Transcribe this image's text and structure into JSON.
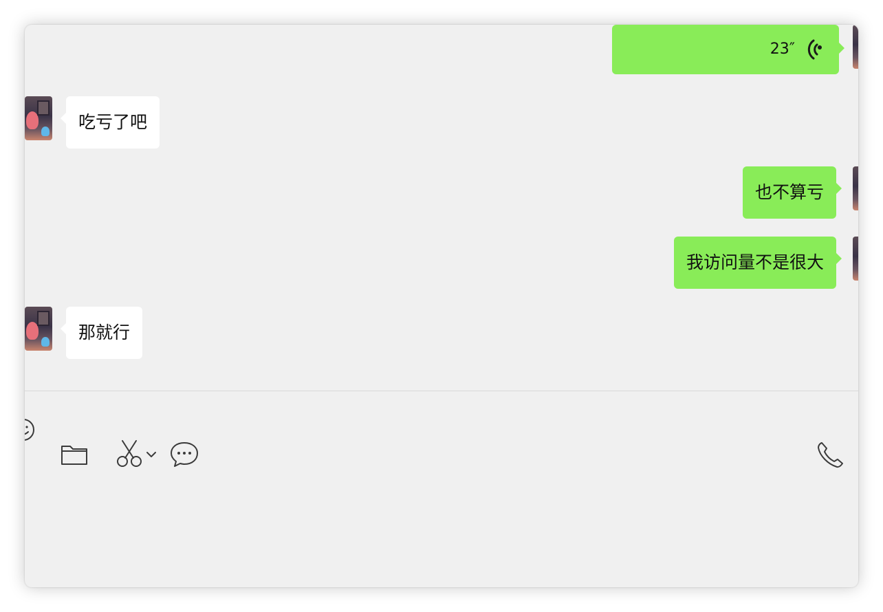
{
  "messages": [
    {
      "direction": "out",
      "type": "voice",
      "duration": "23″",
      "icon": "voice-wave-icon"
    },
    {
      "direction": "in",
      "type": "text",
      "text": "吃亏了吧"
    },
    {
      "direction": "out",
      "type": "text",
      "text": "也不算亏"
    },
    {
      "direction": "out",
      "type": "text",
      "text": "我访问量不是很大"
    },
    {
      "direction": "in",
      "type": "text",
      "text": "那就行"
    }
  ],
  "toolbar": {
    "left_icons": [
      "emoji-icon",
      "folder-icon",
      "scissors-icon",
      "chevron-down-icon",
      "chat-bubble-icon"
    ],
    "right_icons": [
      "phone-icon"
    ]
  },
  "colors": {
    "window_background": "#f0f0f0",
    "outgoing_bubble": "#89ec58",
    "incoming_bubble": "#ffffff",
    "icon": "#3a3a3a"
  }
}
